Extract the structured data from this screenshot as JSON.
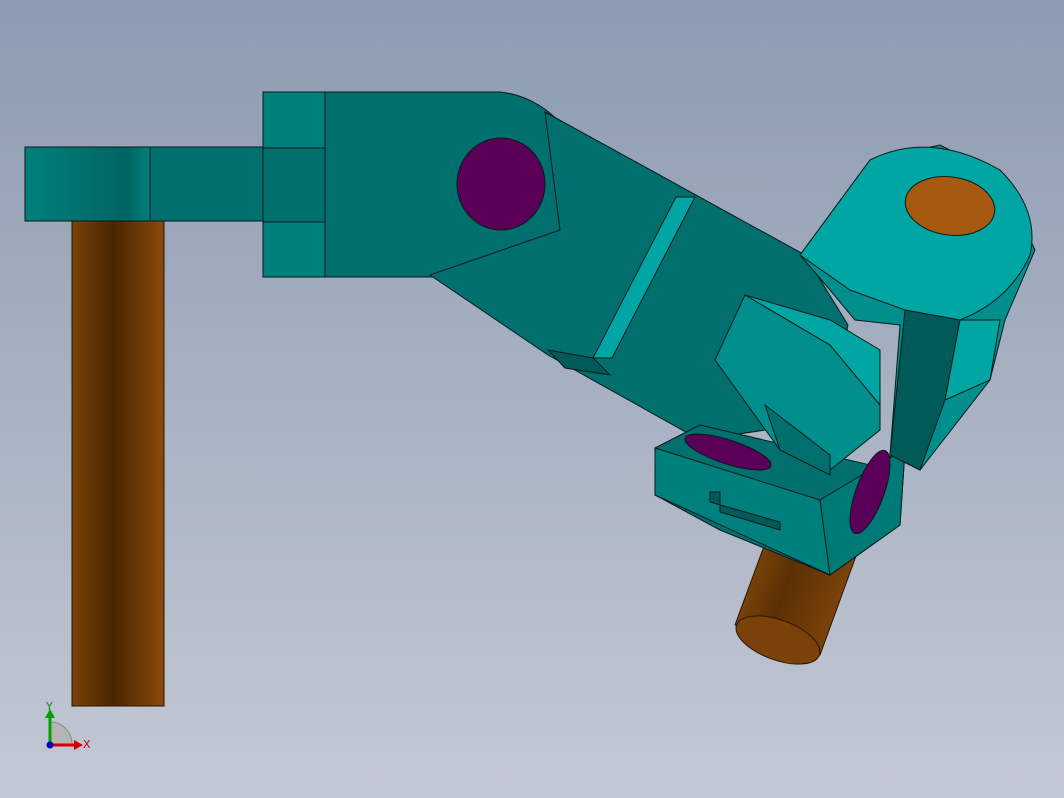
{
  "viewport": {
    "background_top": "#8c9bb0",
    "background_bottom": "#c3c8d4"
  },
  "colors": {
    "teal_main": "#006f6d",
    "teal_light": "#00908d",
    "teal_bright": "#00a6a3",
    "teal_dark": "#005a58",
    "shaft_dark": "#4a2600",
    "shaft_mid": "#7a4208",
    "shaft_light": "#9a5410",
    "pin_purple": "#5a0058",
    "outline": "#0a1a1a"
  },
  "triad": {
    "x_label": "X",
    "y_label": "Y",
    "x_color": "#d00000",
    "y_color": "#00a000",
    "z_color": "#0000c0"
  }
}
